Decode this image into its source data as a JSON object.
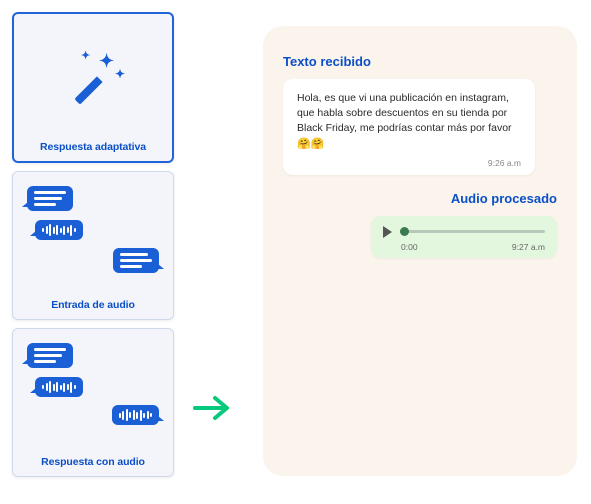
{
  "cards": [
    {
      "label": "Respuesta adaptativa"
    },
    {
      "label": "Entrada de audio"
    },
    {
      "label": "Respuesta con audio"
    }
  ],
  "chat": {
    "received_title": "Texto recibido",
    "received_body": "Hola, es que vi una publicación en instagram, que habla sobre descuentos en su tienda por Black Friday,  me podrías contar más por favor ",
    "received_emoji": "🤗🤗",
    "received_time": "9:26 a.m",
    "processed_title": "Audio procesado",
    "audio_position": "0:00",
    "audio_time": "9:27 a.m"
  }
}
